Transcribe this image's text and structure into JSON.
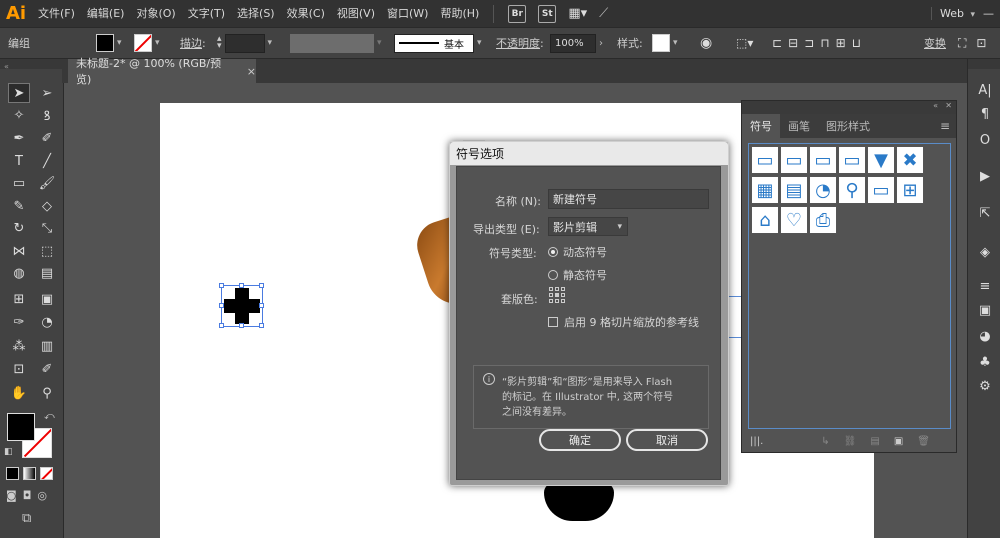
{
  "app": {
    "logo": "Ai",
    "workspace": "Web"
  },
  "menu": [
    "文件(F)",
    "编辑(E)",
    "对象(O)",
    "文字(T)",
    "选择(S)",
    "效果(C)",
    "视图(V)",
    "窗口(W)",
    "帮助(H)"
  ],
  "menu_icons": {
    "br": "Br",
    "st": "St"
  },
  "control_bar": {
    "group_label": "编组",
    "stroke_label": "描边",
    "stroke_style": "基本",
    "opacity_label": "不透明度",
    "opacity_value": "100%",
    "style_label": "样式",
    "transform_label": "变换"
  },
  "document_tab": {
    "title": "未标题-2* @ 100% (RGB/预览)",
    "close": "×"
  },
  "symbols_panel": {
    "tabs": [
      "符号",
      "画笔",
      "图形样式"
    ],
    "active_tab": "符号",
    "symbols": [
      {
        "name": "bar-1",
        "glyph": "▭"
      },
      {
        "name": "bar-2",
        "glyph": "▭"
      },
      {
        "name": "bar-3",
        "glyph": "▭"
      },
      {
        "name": "bar-4",
        "glyph": "▭"
      },
      {
        "name": "dropdown-arrow",
        "glyph": "▼"
      },
      {
        "name": "close-x",
        "glyph": "✖"
      },
      {
        "name": "calendar",
        "glyph": "▦"
      },
      {
        "name": "film",
        "glyph": "▤"
      },
      {
        "name": "rss",
        "glyph": "◔"
      },
      {
        "name": "magnifier",
        "glyph": "⚲"
      },
      {
        "name": "credit-card",
        "glyph": "▭"
      },
      {
        "name": "cart",
        "glyph": "⊞"
      },
      {
        "name": "home",
        "glyph": "⌂"
      },
      {
        "name": "heart-plus",
        "glyph": "♡"
      },
      {
        "name": "printer",
        "glyph": "⎙"
      }
    ]
  },
  "dialog": {
    "title": "符号选项",
    "name_label": "名称 (N):",
    "name_value": "新建符号",
    "export_type_label": "导出类型 (E):",
    "export_type_value": "影片剪辑",
    "symbol_type_label": "符号类型:",
    "dynamic_symbol": "动态符号",
    "static_symbol": "静态符号",
    "registration_label": "套版色:",
    "nine_slice_label": "启用 9 格切片缩放的参考线",
    "info_text_1": "“影片剪辑”和“图形”是用来导入 Flash",
    "info_text_2": "的标记。在 Illustrator 中, 这两个符号",
    "info_text_3": "之间没有差异。",
    "ok": "确定",
    "cancel": "取消"
  }
}
